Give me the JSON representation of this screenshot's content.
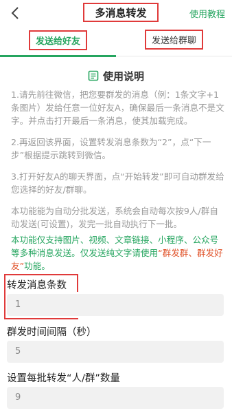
{
  "header": {
    "title": "多消息转发",
    "tutorial_link": "使用教程"
  },
  "tabs": [
    {
      "label": "发送给好友",
      "active": true
    },
    {
      "label": "发送给群聊",
      "active": false
    }
  ],
  "section": {
    "title": "使用说明",
    "icon": "document-icon"
  },
  "instructions": [
    "1.请先前往微信，把您要群发的消息（例：1条文字+1条图片）发给任意一位好友A，确保最后一条消息不是文字。并点击打开最后一条消息，使其加载完成。",
    "2.再返回该界面，设置转发消息条数为“2”，点“下一步”根据提示跳转到微信。",
    "3.打开好友A的聊天界面，点“开始转发”即可自动群发给您选择的好友/群聊。",
    "本功能能为自动分批发送，系统会自动每次按9人/群自动发送(可设置)，发完一批自动执行下一批。"
  ],
  "notice": {
    "text": "本功能仅支持图片、视频、文章链接、小程序、公众号等多种消息发送。仅发送纯文字请使用",
    "highlight": "“群发群、群发好友”",
    "suffix": "功能。"
  },
  "fields": [
    {
      "label": "转发消息条数",
      "value": "1"
    },
    {
      "label": "群发时间间隔（秒）",
      "value": "5"
    },
    {
      "label": "设置每批转发“人/群”数量",
      "value": "9"
    }
  ],
  "colors": {
    "accent": "#25a55f",
    "highlight": "#e0532a",
    "annotation": "#e03a3a"
  }
}
